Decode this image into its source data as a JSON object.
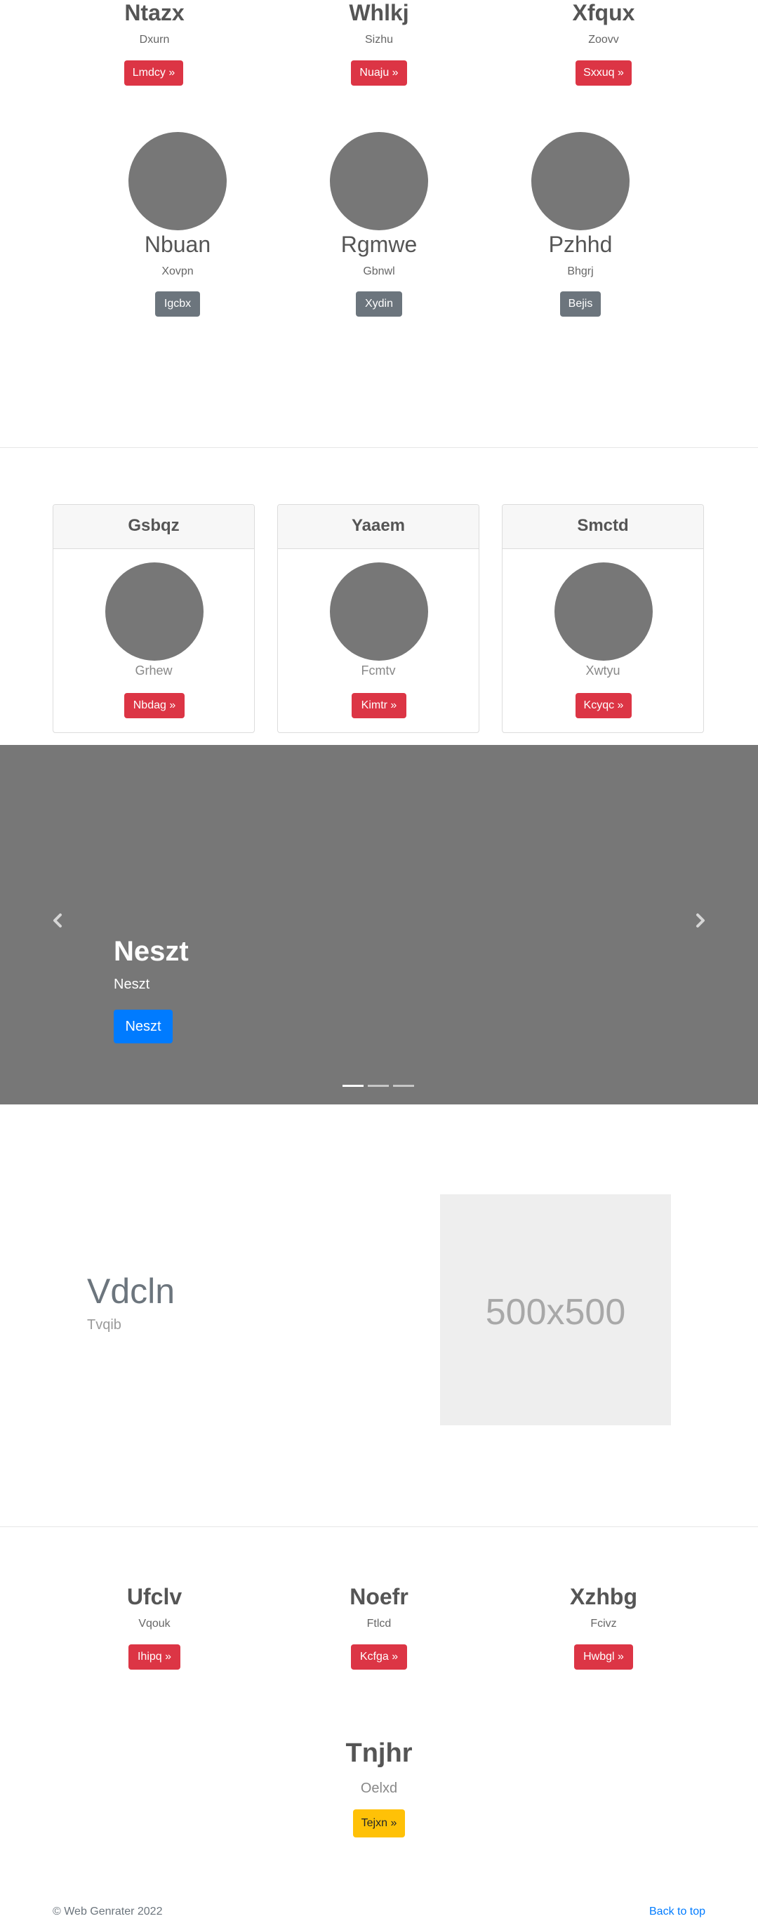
{
  "section1": {
    "items": [
      {
        "title": "Ntazx",
        "subtitle": "Dxurn",
        "button": "Lmdcy »"
      },
      {
        "title": "Whlkj",
        "subtitle": "Sizhu",
        "button": "Nuaju »"
      },
      {
        "title": "Xfqux",
        "subtitle": "Zoovv",
        "button": "Sxxuq »"
      }
    ]
  },
  "section2": {
    "items": [
      {
        "title": "Nbuan",
        "subtitle": "Xovpn",
        "button": "Igcbx"
      },
      {
        "title": "Rgmwe",
        "subtitle": "Gbnwl",
        "button": "Xydin"
      },
      {
        "title": "Pzhhd",
        "subtitle": "Bhgrj",
        "button": "Bejis"
      }
    ]
  },
  "cards": {
    "items": [
      {
        "header": "Gsbqz",
        "subtitle": "Grhew",
        "button": "Nbdag »"
      },
      {
        "header": "Yaaem",
        "subtitle": "Fcmtv",
        "button": "Kimtr »"
      },
      {
        "header": "Smctd",
        "subtitle": "Xwtyu",
        "button": "Kcyqc »"
      }
    ]
  },
  "carousel": {
    "title": "Neszt",
    "subtitle": "Neszt",
    "button": "Neszt",
    "prev_icon": "chevron-left-icon",
    "next_icon": "chevron-right-icon",
    "active_indicator": 0,
    "indicator_count": 3
  },
  "feature": {
    "title": "Vdcln",
    "subtitle": "Tvqib",
    "placeholder_label": "500x500"
  },
  "section3": {
    "items": [
      {
        "title": "Ufclv",
        "subtitle": "Vqouk",
        "button": "Ihipq »"
      },
      {
        "title": "Noefr",
        "subtitle": "Ftlcd",
        "button": "Kcfga »"
      },
      {
        "title": "Xzhbg",
        "subtitle": "Fcivz",
        "button": "Hwbgl »"
      }
    ]
  },
  "single": {
    "title": "Tnjhr",
    "subtitle": "Oelxd",
    "button": "Tejxn »"
  },
  "footer": {
    "copyright": "© Web Genrater 2022",
    "back_to_top": "Back to top"
  },
  "colors": {
    "danger": "#dc3545",
    "secondary": "#6c757d",
    "primary": "#007bff",
    "warning": "#ffc107",
    "link": "#007bff"
  }
}
